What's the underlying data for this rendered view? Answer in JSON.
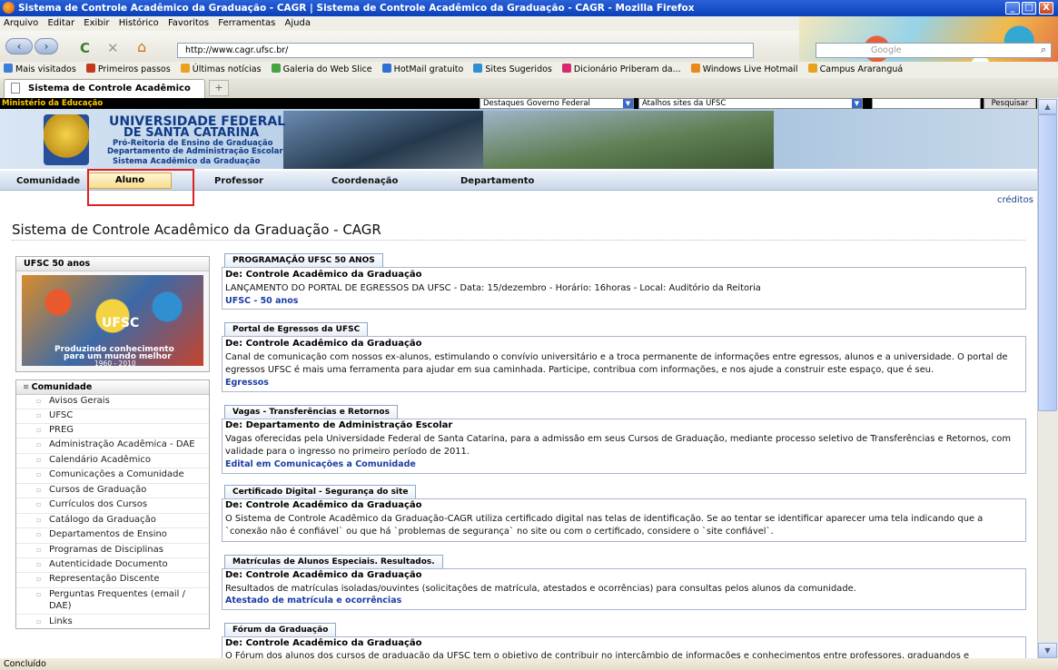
{
  "window": {
    "title": "Sistema de Controle Acadêmico da Graduação - CAGR | Sistema de Controle Acadêmico da Graduação - CAGR - Mozilla Firefox",
    "minimize": "_",
    "maximize": "□",
    "close": "X"
  },
  "menu": [
    "Arquivo",
    "Editar",
    "Exibir",
    "Histórico",
    "Favoritos",
    "Ferramentas",
    "Ajuda"
  ],
  "nav": {
    "back": "‹",
    "forward": "›",
    "reload": "C",
    "stop": "✕",
    "home": "⌂",
    "url": "http://www.cagr.ufsc.br/",
    "search_placeholder": "Google"
  },
  "bookmarks": [
    "Mais visitados",
    "Primeiros passos",
    "Últimas notícias",
    "Galeria do Web Slice",
    "HotMail gratuito",
    "Sites Sugeridos",
    "Dicionário Priberam da...",
    "Windows Live Hotmail",
    "Campus Araranguá"
  ],
  "tab": {
    "label": "Sistema de Controle Acadêmico da G...",
    "add": "+"
  },
  "gov_bar": {
    "ministerio": "Ministério da Educação",
    "destaques": "Destaques Governo Federal",
    "atalhos": "Atalhos sites da UFSC",
    "pesquisar": "Pesquisar"
  },
  "header": {
    "line1": "UNIVERSIDADE FEDERAL",
    "line2": "DE SANTA CATARINA",
    "line3": "Pró-Reitoria de Ensino de Graduação",
    "line4": "Departamento de Administração Escolar",
    "line5": "Sistema Acadêmico da Graduação"
  },
  "tabs": [
    "Comunidade",
    "Aluno",
    "Professor",
    "Coordenação",
    "Departamento"
  ],
  "creditos": "créditos",
  "page_title": "Sistema de Controle Acadêmico da Graduação - CAGR",
  "left_panel": {
    "ufsc50_title": "UFSC 50 anos",
    "ufsc50_logo": "UFSC",
    "ufsc50_slogan1": "Produzindo conhecimento",
    "ufsc50_slogan2": "para um mundo melhor",
    "ufsc50_years": "1960 - 2010",
    "comunidade_title": "Comunidade",
    "items": [
      "Avisos Gerais",
      "UFSC",
      "PREG",
      "Administração Acadêmica - DAE",
      "Calendário Acadêmico",
      "Comunicações a Comunidade",
      "Cursos de Graduação",
      "Currículos dos Cursos",
      "Catálogo da Graduação",
      "Departamentos de Ensino",
      "Programas de Disciplinas",
      "Autenticidade Documento",
      "Representação Discente",
      "Perguntas Frequentes (email / DAE)",
      "Links"
    ]
  },
  "news": [
    {
      "title": "PROGRAMAÇÃO UFSC 50 ANOS",
      "from": "De: Controle Acadêmico da Graduação",
      "body": "LANÇAMENTO DO PORTAL DE EGRESSOS DA UFSC - Data: 15/dezembro - Horário: 16horas - Local: Auditório da Reitoria",
      "link": "UFSC - 50 anos"
    },
    {
      "title": "Portal de Egressos da UFSC",
      "from": "De: Controle Acadêmico da Graduação",
      "body": "Canal de comunicação com nossos ex-alunos, estimulando o convívio universitário e a troca permanente de informações entre egressos, alunos e a universidade. O portal de egressos UFSC é mais uma ferramenta para ajudar em sua caminhada. Participe, contribua com informações, e nos ajude a construir este espaço, que é seu.",
      "link": "Egressos"
    },
    {
      "title": "Vagas - Transferências e Retornos",
      "from": "De: Departamento de Administração Escolar",
      "body": "Vagas oferecidas pela Universidade Federal de Santa Catarina, para a admissão em seus Cursos de Graduação, mediante processo seletivo de Transferências e Retornos, com validade para o ingresso no primeiro período de 2011.",
      "link": "Edital em Comunicações a Comunidade"
    },
    {
      "title": "Certificado Digital - Segurança do site",
      "from": "De: Controle Acadêmico da Graduação",
      "body": "O Sistema de Controle Acadêmico da Graduação-CAGR utiliza certificado digital nas telas de identificação. Se ao tentar se identificar aparecer uma tela indicando que a `conexão não é confiável` ou que há `problemas de segurança` no site ou com o certificado, considere o `site confiável`.",
      "link": ""
    },
    {
      "title": "Matrículas de Alunos Especiais. Resultados.",
      "from": "De: Controle Acadêmico da Graduação",
      "body": "Resultados de matrículas isoladas/ouvintes (solicitações de matrícula, atestados e ocorrências) para consultas pelos alunos da comunidade.",
      "link": "Atestado de matrícula e ocorrências"
    },
    {
      "title": "Fórum da Graduação",
      "from": "De: Controle Acadêmico da Graduação",
      "body": "O Fórum dos alunos dos cursos de graduação da UFSC tem o objetivo de contribuir no intercâmbio de informações e conhecimentos entre professores, graduandos e",
      "link": ""
    }
  ],
  "status": "Concluído"
}
